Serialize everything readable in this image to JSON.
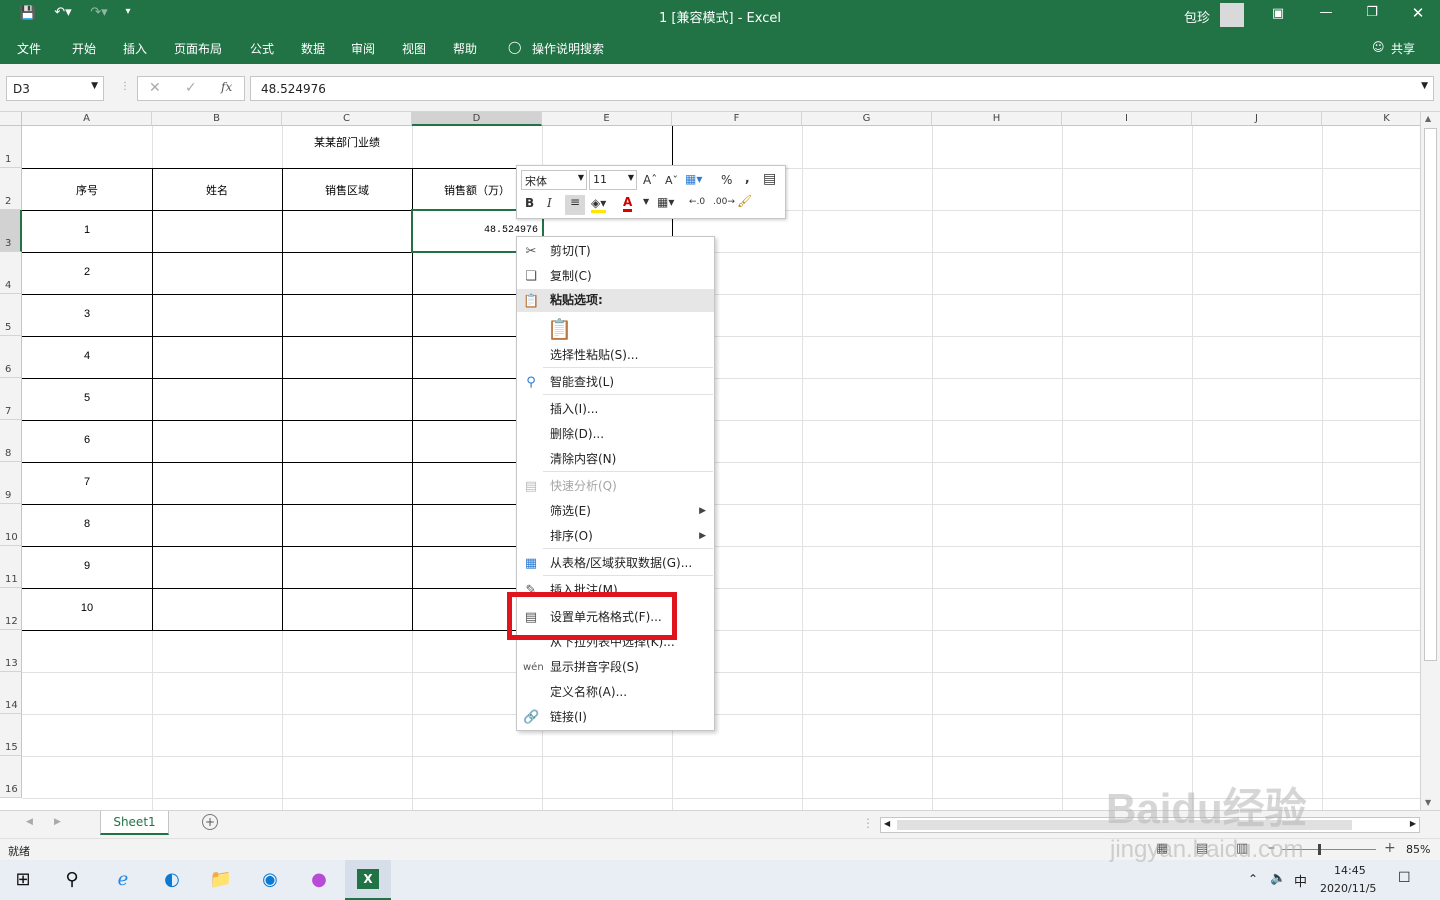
{
  "title_bar": {
    "doc_title": "1  [兼容模式]  -  Excel",
    "user": "包珍"
  },
  "ribbon": {
    "tabs": [
      "文件",
      "开始",
      "插入",
      "页面布局",
      "公式",
      "数据",
      "审阅",
      "视图",
      "帮助"
    ],
    "tell_me": "操作说明搜索",
    "share": "共享"
  },
  "formula_bar": {
    "name_box": "D3",
    "value": "48.524976",
    "fx": "fx"
  },
  "columns": [
    "A",
    "B",
    "C",
    "D",
    "E",
    "F",
    "G",
    "H",
    "I",
    "J",
    "K"
  ],
  "rows": [
    "1",
    "2",
    "3",
    "4",
    "5",
    "6",
    "7",
    "8",
    "9",
    "10",
    "11",
    "12",
    "13",
    "14",
    "15",
    "16"
  ],
  "table": {
    "title": "某某部门业绩",
    "headers": [
      "序号",
      "姓名",
      "销售区域",
      "销售额（万）"
    ],
    "seq": [
      "1",
      "2",
      "3",
      "4",
      "5",
      "6",
      "7",
      "8",
      "9",
      "10"
    ],
    "d3": "48.524976"
  },
  "mini_toolbar": {
    "font": "宋体",
    "size": "11"
  },
  "context_menu": {
    "cut": "剪切(T)",
    "copy": "复制(C)",
    "paste_options": "粘贴选项:",
    "paste_special": "选择性粘贴(S)...",
    "smart_lookup": "智能查找(L)",
    "insert": "插入(I)...",
    "delete": "删除(D)...",
    "clear": "清除内容(N)",
    "quick_analysis": "快速分析(Q)",
    "filter": "筛选(E)",
    "sort": "排序(O)",
    "from_table": "从表格/区域获取数据(G)...",
    "insert_comment": "插入批注(M)",
    "format_cells": "设置单元格格式(F)...",
    "pick_list": "从下拉列表中选择(K)...",
    "phonetic": "显示拼音字段(S)",
    "define_name": "定义名称(A)...",
    "link": "链接(I)"
  },
  "sheet_tab": "Sheet1",
  "status": {
    "ready": "就绪",
    "zoom": "85%"
  },
  "taskbar": {
    "time": "14:45",
    "date": "2020/11/5",
    "ime": "中"
  },
  "watermark": {
    "line1": "Baidu经验",
    "line2": "jingyan.baidu.com"
  },
  "colors": {
    "excel_green": "#217346",
    "highlight_red": "#e0141e"
  }
}
